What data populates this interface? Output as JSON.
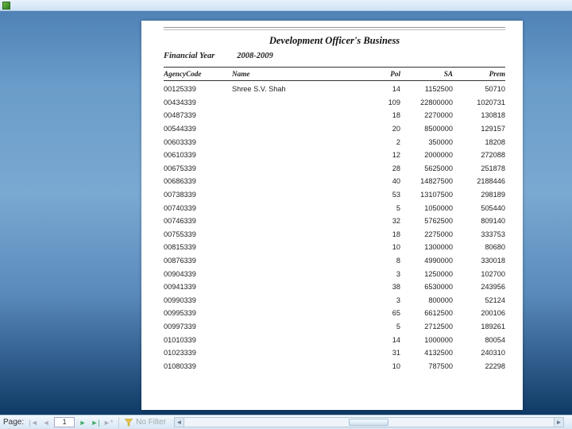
{
  "report": {
    "title": "Development Officer's Business",
    "fy_label": "Financial Year",
    "fy_value": "2008-2009",
    "columns": {
      "agency": "AgencyCode",
      "name": "Name",
      "pol": "Pol",
      "sa": "SA",
      "prem": "Prem"
    },
    "rows": [
      {
        "agency": "00125339",
        "name": "Shree S.V. Shah",
        "pol": "14",
        "sa": "1152500",
        "prem": "50710"
      },
      {
        "agency": "00434339",
        "name": "",
        "pol": "109",
        "sa": "22800000",
        "prem": "1020731"
      },
      {
        "agency": "00487339",
        "name": "",
        "pol": "18",
        "sa": "2270000",
        "prem": "130818"
      },
      {
        "agency": "00544339",
        "name": "",
        "pol": "20",
        "sa": "8500000",
        "prem": "129157"
      },
      {
        "agency": "00603339",
        "name": "",
        "pol": "2",
        "sa": "350000",
        "prem": "18208"
      },
      {
        "agency": "00610339",
        "name": "",
        "pol": "12",
        "sa": "2000000",
        "prem": "272088"
      },
      {
        "agency": "00675339",
        "name": "",
        "pol": "28",
        "sa": "5625000",
        "prem": "251878"
      },
      {
        "agency": "00686339",
        "name": "",
        "pol": "40",
        "sa": "14827500",
        "prem": "2188446"
      },
      {
        "agency": "00738339",
        "name": "",
        "pol": "53",
        "sa": "13107500",
        "prem": "298189"
      },
      {
        "agency": "00740339",
        "name": "",
        "pol": "5",
        "sa": "1050000",
        "prem": "505440"
      },
      {
        "agency": "00746339",
        "name": "",
        "pol": "32",
        "sa": "5762500",
        "prem": "809140"
      },
      {
        "agency": "00755339",
        "name": "",
        "pol": "18",
        "sa": "2275000",
        "prem": "333753"
      },
      {
        "agency": "00815339",
        "name": "",
        "pol": "10",
        "sa": "1300000",
        "prem": "80680"
      },
      {
        "agency": "00876339",
        "name": "",
        "pol": "8",
        "sa": "4990000",
        "prem": "330018"
      },
      {
        "agency": "00904339",
        "name": "",
        "pol": "3",
        "sa": "1250000",
        "prem": "102700"
      },
      {
        "agency": "00941339",
        "name": "",
        "pol": "38",
        "sa": "6530000",
        "prem": "243956"
      },
      {
        "agency": "00990339",
        "name": "",
        "pol": "3",
        "sa": "800000",
        "prem": "52124"
      },
      {
        "agency": "00995339",
        "name": "",
        "pol": "65",
        "sa": "6612500",
        "prem": "200106"
      },
      {
        "agency": "00997339",
        "name": "",
        "pol": "5",
        "sa": "2712500",
        "prem": "189261"
      },
      {
        "agency": "01010339",
        "name": "",
        "pol": "14",
        "sa": "1000000",
        "prem": "80054"
      },
      {
        "agency": "01023339",
        "name": "",
        "pol": "31",
        "sa": "4132500",
        "prem": "240310"
      },
      {
        "agency": "01080339",
        "name": "",
        "pol": "10",
        "sa": "787500",
        "prem": "22298"
      }
    ]
  },
  "nav": {
    "page_label": "Page:",
    "first": "|◄",
    "prev": "◄",
    "current_page": "1",
    "next": "►",
    "last": "►|",
    "new": "►*",
    "filter_text": "No Filter",
    "scroll_left": "◄",
    "scroll_right": "►"
  }
}
